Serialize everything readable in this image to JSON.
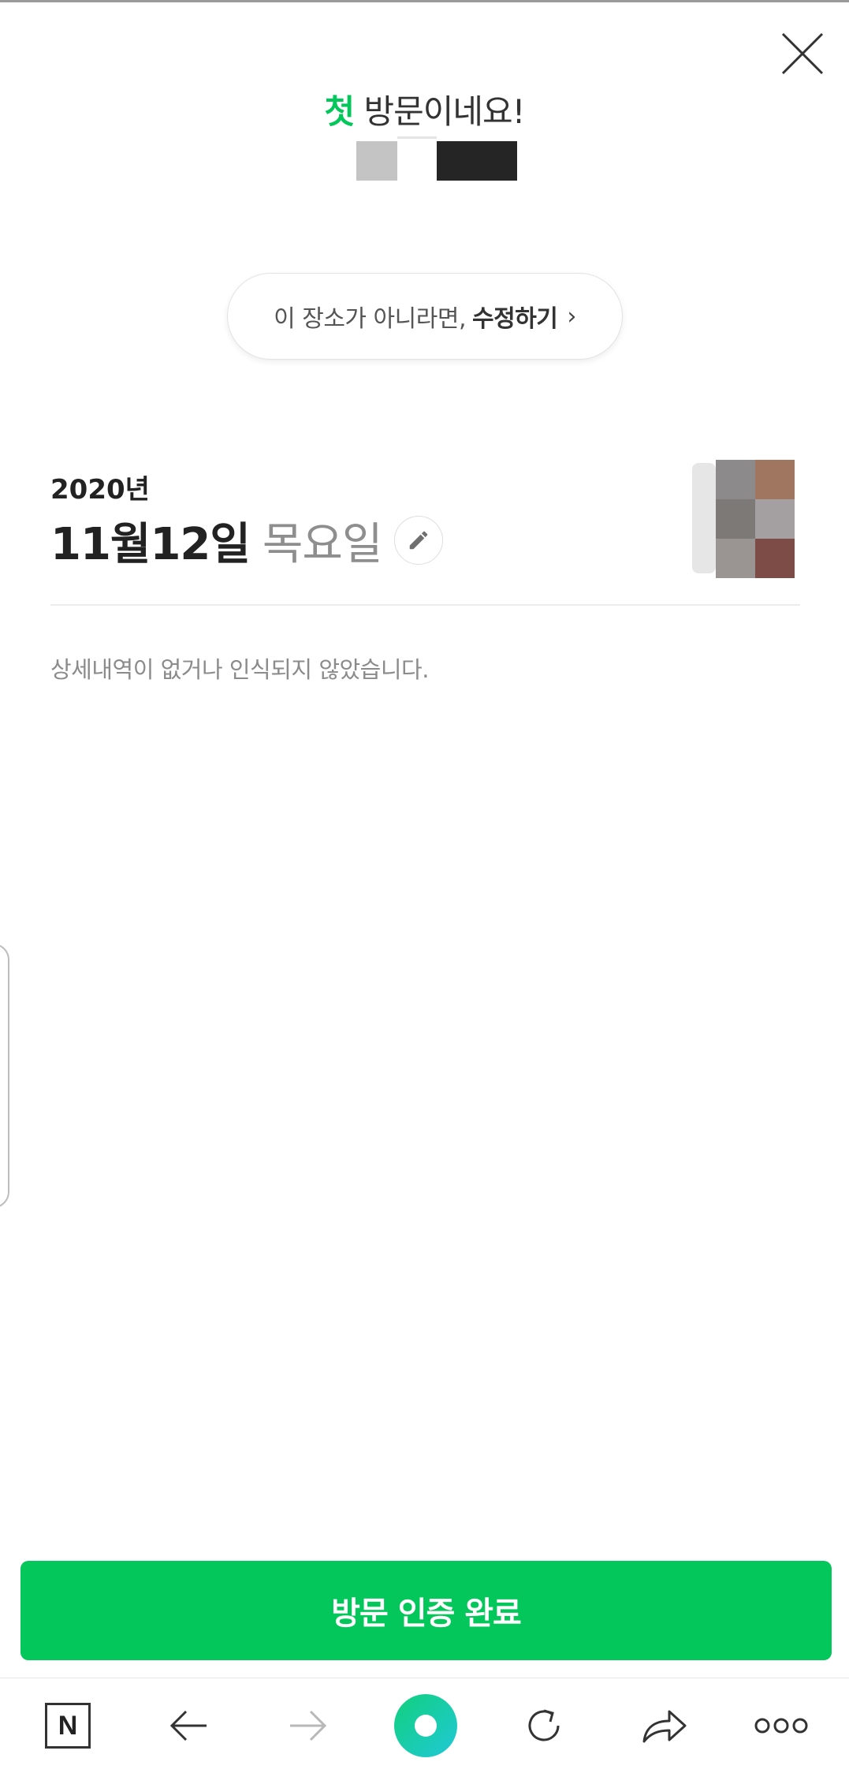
{
  "header": {
    "headline_accent": "첫",
    "headline_rest": " 방문이네요!",
    "close_icon": "close-icon"
  },
  "place": {
    "edit_prefix": "이 장소가 아니라면,",
    "edit_action": "수정하기",
    "edit_chevron": "›"
  },
  "visit": {
    "year": "2020년",
    "date": "11월12일",
    "weekday": "목요일",
    "edit_icon": "pencil-icon"
  },
  "details": {
    "message": "상세내역이 없거나 인식되지 않았습니다."
  },
  "actions": {
    "complete_label": "방문 인증 완료",
    "complete_color": "#03c75a"
  },
  "browser_toolbar": {
    "home_label": "N",
    "icons": [
      "naver-home-icon",
      "back-arrow-icon",
      "forward-arrow-icon",
      "green-dot-icon",
      "refresh-icon",
      "share-icon",
      "more-icon"
    ]
  }
}
